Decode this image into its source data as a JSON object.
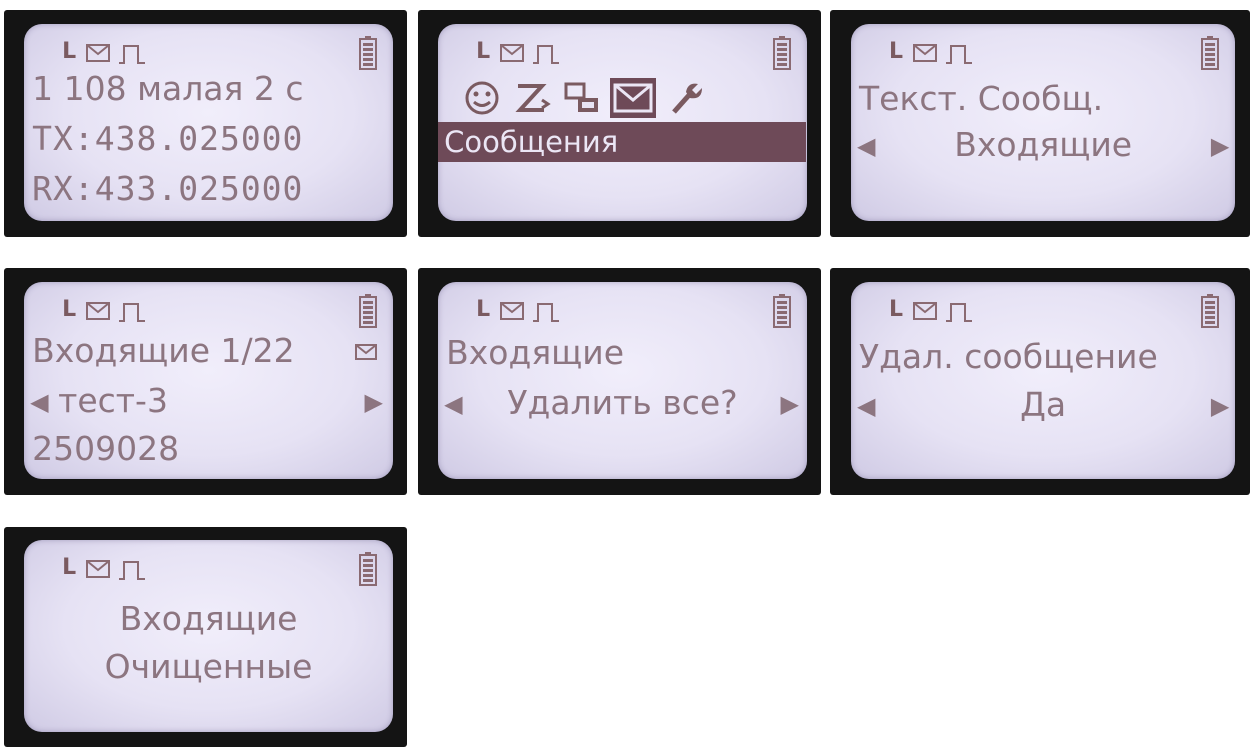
{
  "screens": [
    {
      "name": "channel",
      "lines": [
        "1 108 малая 2 с",
        "TX:438.025000",
        "RX:433.025000"
      ]
    },
    {
      "name": "menu",
      "selected_label": "Сообщения",
      "icons": [
        "smiley-icon",
        "zz-icon",
        "network-icon",
        "envelope-icon",
        "wrench-icon"
      ]
    },
    {
      "name": "messages-type",
      "title": "Текст. Сообщ.",
      "option": "Входящие"
    },
    {
      "name": "inbox",
      "title": "Входящие 1/22",
      "item": "тест-3",
      "detail": "2509028"
    },
    {
      "name": "delete-all",
      "title": "Входящие",
      "option": "Удалить все?"
    },
    {
      "name": "delete-confirm",
      "title": "Удал. сообщение",
      "option": "Да"
    },
    {
      "name": "cleared",
      "line1": "Входящие",
      "line2": "Очищенные"
    }
  ],
  "status": {
    "letter": "L"
  }
}
